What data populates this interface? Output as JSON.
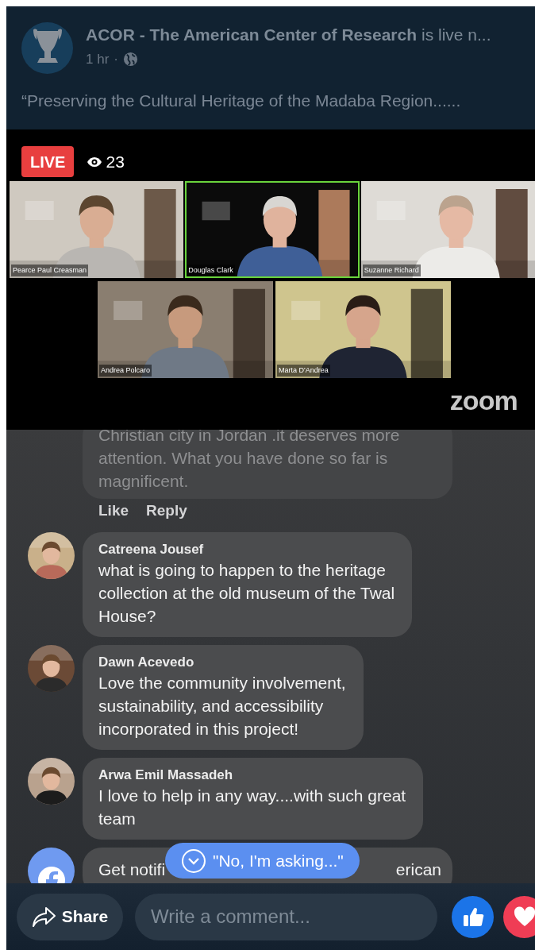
{
  "post": {
    "page_name": "ACOR - The American Center of Research",
    "headline_suffix": "is live n...",
    "time": "1 hr",
    "separator": "·",
    "caption": "“Preserving the Cultural Heritage of the Madaba Region......"
  },
  "video": {
    "live_label": "LIVE",
    "viewers": "23",
    "watermark": "zoom",
    "participants": [
      {
        "name": "Pearce Paul Creasman",
        "active_speaker": false
      },
      {
        "name": "Douglas Clark",
        "active_speaker": true
      },
      {
        "name": "Suzanne Richard",
        "active_speaker": false
      },
      {
        "name": "Andrea Polcaro",
        "active_speaker": false
      },
      {
        "name": "Marta D'Andrea",
        "active_speaker": false
      }
    ]
  },
  "comments": [
    {
      "kind": "tail",
      "lines": [
        "Christian city in Jordan .it deserves more",
        "attention. What you have done so far is",
        "magnificent."
      ],
      "actions": [
        "Like",
        "Reply"
      ]
    },
    {
      "kind": "comment",
      "author": "Catreena Jousef",
      "lines": [
        "what is going to happen to the heritage",
        "collection at the old museum of the Twal",
        "House?"
      ]
    },
    {
      "kind": "comment",
      "author": "Dawn Acevedo",
      "lines": [
        "Love the community involvement,",
        "sustainability, and accessibility",
        "incorporated in this project!"
      ]
    },
    {
      "kind": "comment",
      "author": "Arwa Emil Massadeh",
      "lines": [
        "I love to help in any way....with such great",
        "team"
      ]
    },
    {
      "kind": "notice",
      "fragments": [
        "Get notifi",
        "erican"
      ]
    }
  ],
  "new_comment_pill": "\"No, I'm asking...\"",
  "composer": {
    "share_label": "Share",
    "placeholder": "Write a comment..."
  }
}
